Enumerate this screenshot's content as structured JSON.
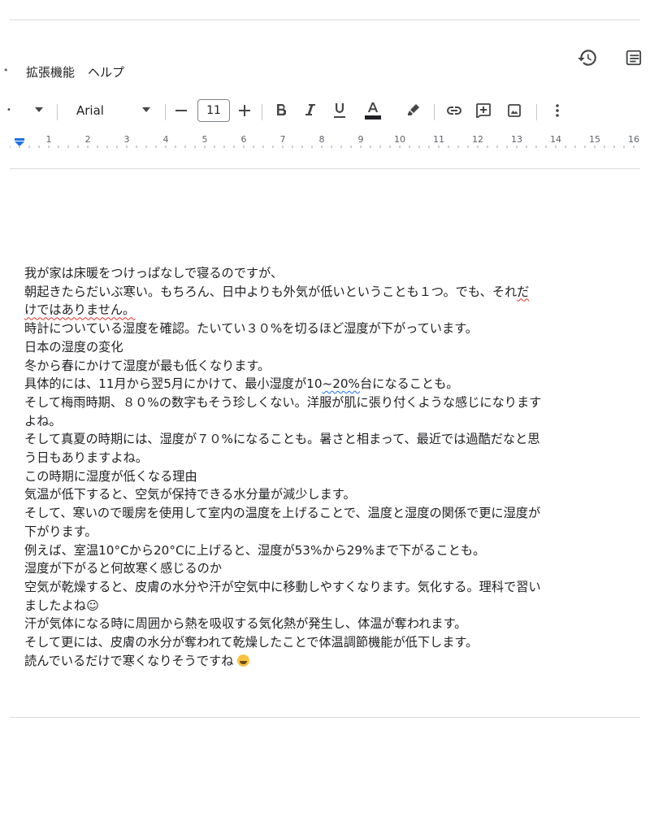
{
  "menu": {
    "items": [
      "拡張機能",
      "ヘルプ"
    ]
  },
  "toolbar": {
    "font": "Arial",
    "font_size": "11"
  },
  "ruler": {
    "numbers": [
      "1",
      "2",
      "3",
      "4",
      "5",
      "6",
      "7",
      "8",
      "9",
      "10",
      "11",
      "12",
      "13",
      "14",
      "15",
      "16"
    ]
  },
  "icons": {
    "history": "history-icon",
    "comments": "comments-icon",
    "accent_color": "#1a73e8"
  },
  "document": {
    "lines": [
      "我が家は床暖をつけっぱなしで寝るのですが、",
      "朝起きたらだいぶ寒い。もちろん、日中よりも外気が低いということも１つ。でも、それだ",
      "けではありません。",
      "時計についている湿度を確認。たいてい３０%を切るほど湿度が下がっています。",
      "日本の湿度の変化",
      "冬から春にかけて湿度が最も低くなります。",
      "具体的には、11月から翌5月にかけて、最小湿度が10~20%台になることも。",
      "そして梅雨時期、８０%の数字もそう珍しくない。洋服が肌に張り付くような感じになります",
      "よね。",
      "そして真夏の時期には、湿度が７０%になることも。暑さと相まって、最近では過酷だなと思",
      "う日もありますよね。",
      "この時期に湿度が低くなる理由",
      "気温が低下すると、空気が保持できる水分量が減少します。",
      "そして、寒いので暖房を使用して室内の温度を上げることで、温度と湿度の関係で更に湿度が",
      "下がります。",
      "例えば、室温10°Cから20°Cに上げると、湿度が53%から29%まで下がることも。",
      "湿度が下がると何故寒く感じるのか",
      "空気が乾燥すると、皮膚の水分や汗が空気中に移動しやすくなります。気化する。理科で習い",
      "ましたよね☺",
      "汗が気体になる時に周囲から熱を吸収する気化熱が発生し、体温が奪われます。",
      "そして更には、皮膚の水分が奪われて乾燥したことで体温調節機能が低下します。",
      "読んでいるだけで寒くなりそうですね"
    ]
  }
}
